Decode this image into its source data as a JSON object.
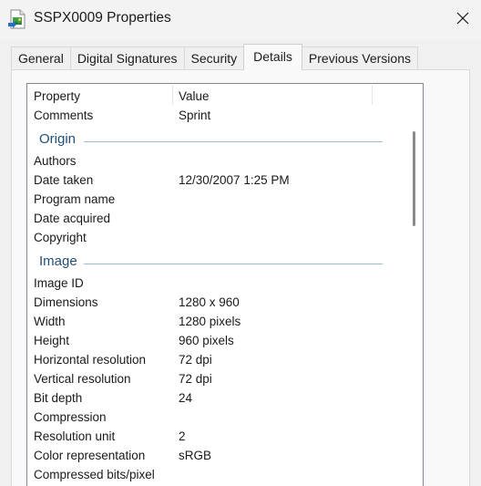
{
  "window": {
    "title": "SSPX0009 Properties"
  },
  "tabs": [
    {
      "label": "General"
    },
    {
      "label": "Digital Signatures"
    },
    {
      "label": "Security"
    },
    {
      "label": "Details"
    },
    {
      "label": "Previous Versions"
    }
  ],
  "active_tab": "Details",
  "details": {
    "header": {
      "property": "Property",
      "value": "Value"
    },
    "comments": {
      "key": "Comments",
      "value": "Sprint"
    },
    "origin": {
      "title": "Origin",
      "rows": [
        {
          "key": "Authors",
          "value": ""
        },
        {
          "key": "Date taken",
          "value": "12/30/2007 1:25 PM"
        },
        {
          "key": "Program name",
          "value": ""
        },
        {
          "key": "Date acquired",
          "value": ""
        },
        {
          "key": "Copyright",
          "value": ""
        }
      ]
    },
    "image": {
      "title": "Image",
      "rows": [
        {
          "key": "Image ID",
          "value": ""
        },
        {
          "key": "Dimensions",
          "value": "1280 x 960"
        },
        {
          "key": "Width",
          "value": "1280 pixels"
        },
        {
          "key": "Height",
          "value": "960 pixels"
        },
        {
          "key": "Horizontal resolution",
          "value": "72 dpi"
        },
        {
          "key": "Vertical resolution",
          "value": "72 dpi"
        },
        {
          "key": "Bit depth",
          "value": "24"
        },
        {
          "key": "Compression",
          "value": ""
        },
        {
          "key": "Resolution unit",
          "value": "2"
        },
        {
          "key": "Color representation",
          "value": "sRGB"
        },
        {
          "key": "Compressed bits/pixel",
          "value": ""
        }
      ]
    }
  }
}
